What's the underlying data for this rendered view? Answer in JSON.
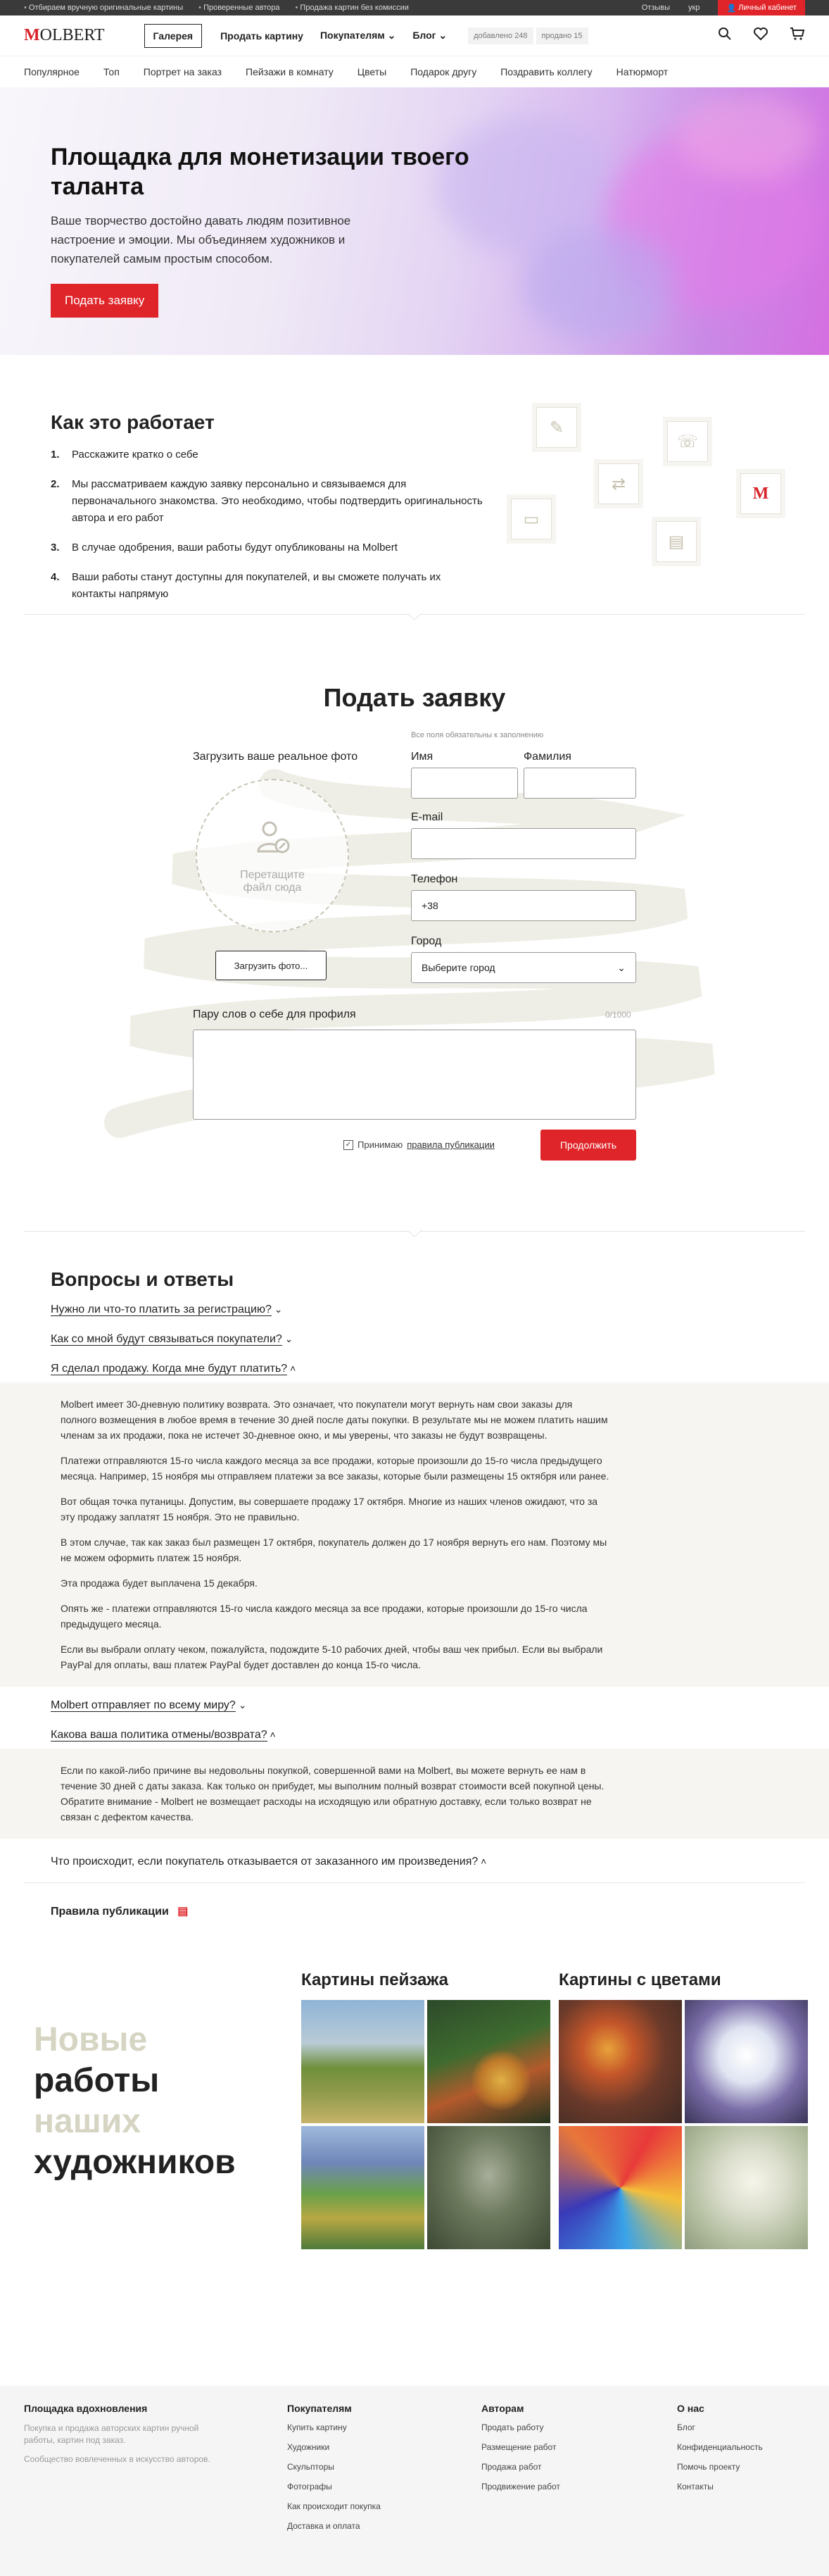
{
  "topbar": {
    "bullets": [
      "Отбираем вручную оригинальные картины",
      "Проверенные автора",
      "Продажа картин без комиссии"
    ],
    "reviews": "Отзывы",
    "lang": "укр",
    "cabinet": "Личный кабинет"
  },
  "header": {
    "logo_first": "M",
    "logo_rest": "OLBERT",
    "gallery": "Галерея",
    "nav": [
      "Продать картину",
      "Покупателям",
      "Блог"
    ],
    "added": "добавлено 248",
    "sold": "продано 15"
  },
  "subnav": [
    "Популярное",
    "Топ",
    "Портрет на заказ",
    "Пейзажи в комнату",
    "Цветы",
    "Подарок другу",
    "Поздравить коллегу",
    "Натюрморт"
  ],
  "hero": {
    "title": "Площадка для монетизации твоего таланта",
    "text": "Ваше творчество достойно давать людям позитивное настроение и эмоции. Мы объединяем художников и покупателей самым простым способом.",
    "button": "Подать заявку"
  },
  "how": {
    "title": "Как это работает",
    "steps": [
      "Расскажите кратко о себе",
      "Мы рассматриваем каждую заявку персонально и связываемся для первоначального знакомства. Это необходимо, чтобы подтвердить оригинальность автора и его работ",
      "В случае одобрения, ваши работы будут опубликованы на Molbert",
      "Ваши работы станут доступны для покупателей, и вы сможете получать их контакты напрямую"
    ]
  },
  "form": {
    "title": "Подать заявку",
    "required_note": "Все поля обязательны к заполнению",
    "upload_title": "Загрузить ваше реальное фото",
    "drop_text": "Перетащите файл сюда",
    "upload_button": "Загрузить фото...",
    "name_label": "Имя",
    "surname_label": "Фамилия",
    "email_label": "E-mail",
    "phone_label": "Телефон",
    "phone_value": "+38",
    "city_label": "Город",
    "city_value": "Выберите город",
    "about_label": "Пару слов о себе для профиля",
    "counter": "0/1000",
    "agree_text": "Принимаю",
    "agree_link": "правила публикации",
    "submit": "Продолжить"
  },
  "faq": {
    "title": "Вопросы и ответы",
    "q1": "Нужно ли что-то платить за регистрацию?",
    "q2": "Как со мной будут связываться покупатели?",
    "q3": "Я сделал продажу. Когда мне будут платить?",
    "a3": [
      "Molbert имеет 30-дневную политику возврата. Это означает, что покупатели могут вернуть нам свои заказы для полного возмещения в любое время в течение 30 дней после даты покупки. В результате мы не можем платить нашим членам за их продажи, пока не истечет 30-дневное окно, и мы уверены, что заказы не будут возвращены.",
      "Платежи отправляются 15-го числа каждого месяца за все продажи, которые произошли до 15-го числа предыдущего месяца. Например, 15 ноября мы отправляем платежи за все заказы, которые были размещены 15 октября или ранее.",
      "Вот общая точка путаницы. Допустим, вы совершаете продажу 17 октября. Многие из наших членов ожидают, что за эту продажу заплатят 15 ноября. Это не правильно.",
      "В этом случае, так как заказ был размещен 17 октября, покупатель должен до 17 ноября вернуть его нам. Поэтому мы не можем оформить платеж 15 ноября.",
      "Эта продажа будет выплачена 15 декабря.",
      "Опять же - платежи отправляются 15-го числа каждого месяца за все продажи, которые произошли до 15-го числа предыдущего месяца.",
      "Если вы выбрали оплату чеком, пожалуйста, подождите 5-10 рабочих дней, чтобы ваш чек прибыл. Если вы выбрали PayPal для оплаты, ваш платеж PayPal будет доставлен до конца 15-го числа."
    ],
    "q4": "Molbert отправляет по всему миру?",
    "q5": "Какова ваша политика отмены/возврата?",
    "a5": "Если по какой-либо причине вы недовольны покупкой, совершенной вами на Molbert, вы можете вернуть ее нам в течение 30 дней с даты заказа. Как только он прибудет, мы выполним полный возврат стоимости всей покупной цены. Обратите внимание - Molbert не возмещает расходы на исходящую или обратную доставку, если только возврат не связан с дефектом качества.",
    "q6": "Что происходит, если покупатель отказывается от заказанного им произведения?",
    "rules": "Правила публикации"
  },
  "works": {
    "line1": "Новые",
    "line2": "работы",
    "line3": "наших",
    "line4": "художников",
    "cat1": "Картины пейзажа",
    "cat2": "Картины с цветами"
  },
  "footer": {
    "col1_title": "Площадка вдохновления",
    "col1_text1": "Покупка и продажа авторских картин ручной работы, картин под заказ.",
    "col1_text2": "Сообщество вовлеченных в искусство авторов.",
    "col2_title": "Покупателям",
    "col2_links": [
      "Купить картину",
      "Художники",
      "Скульпторы",
      "Фотографы",
      "Как происходит покупка",
      "Доставка и оплата"
    ],
    "col3_title": "Авторам",
    "col3_links": [
      "Продать работу",
      "Размещение работ",
      "Продажа работ",
      "Продвижение работ"
    ],
    "col4_title": "О нас",
    "col4_links": [
      "Блог",
      "Конфиденциальность",
      "Помочь проекту",
      "Контакты"
    ]
  },
  "colors": {
    "accent": "#e0252a",
    "hero_violet": "#d56fe2",
    "swirl": "#efeee6"
  }
}
